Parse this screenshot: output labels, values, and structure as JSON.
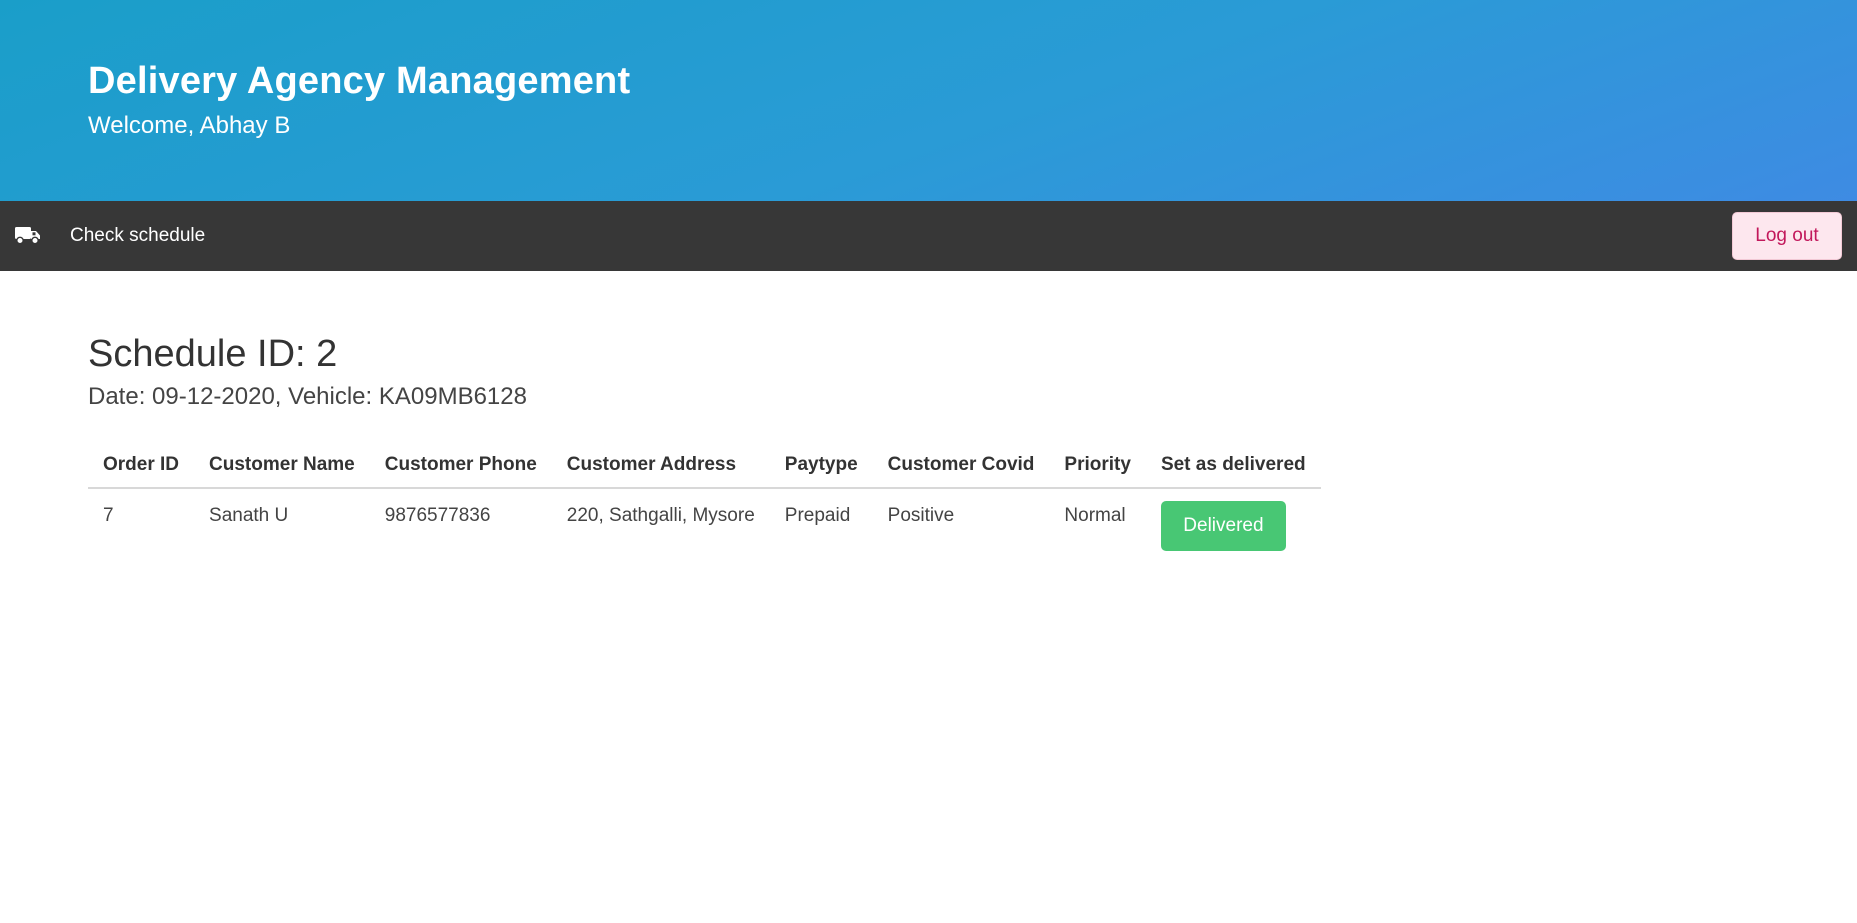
{
  "header": {
    "title": "Delivery Agency Management",
    "welcome": "Welcome, Abhay B"
  },
  "navbar": {
    "brand_icon": "truck-icon",
    "check_schedule": "Check schedule",
    "logout": "Log out"
  },
  "schedule": {
    "title": "Schedule ID: 2",
    "subtitle": "Date: 09-12-2020, Vehicle: KA09MB6128"
  },
  "table": {
    "headers": [
      "Order ID",
      "Customer Name",
      "Customer Phone",
      "Customer Address",
      "Paytype",
      "Customer Covid",
      "Priority",
      "Set as delivered"
    ],
    "rows": [
      {
        "order_id": "7",
        "customer_name": "Sanath U",
        "customer_phone": "9876577836",
        "customer_address": "220, Sathgalli, Mysore",
        "paytype": "Prepaid",
        "customer_covid": "Positive",
        "priority": "Normal",
        "action": "Delivered"
      }
    ]
  },
  "colors": {
    "navbar_bg": "#373737",
    "accent_green": "#48c774",
    "logout_text": "#c2185b"
  }
}
